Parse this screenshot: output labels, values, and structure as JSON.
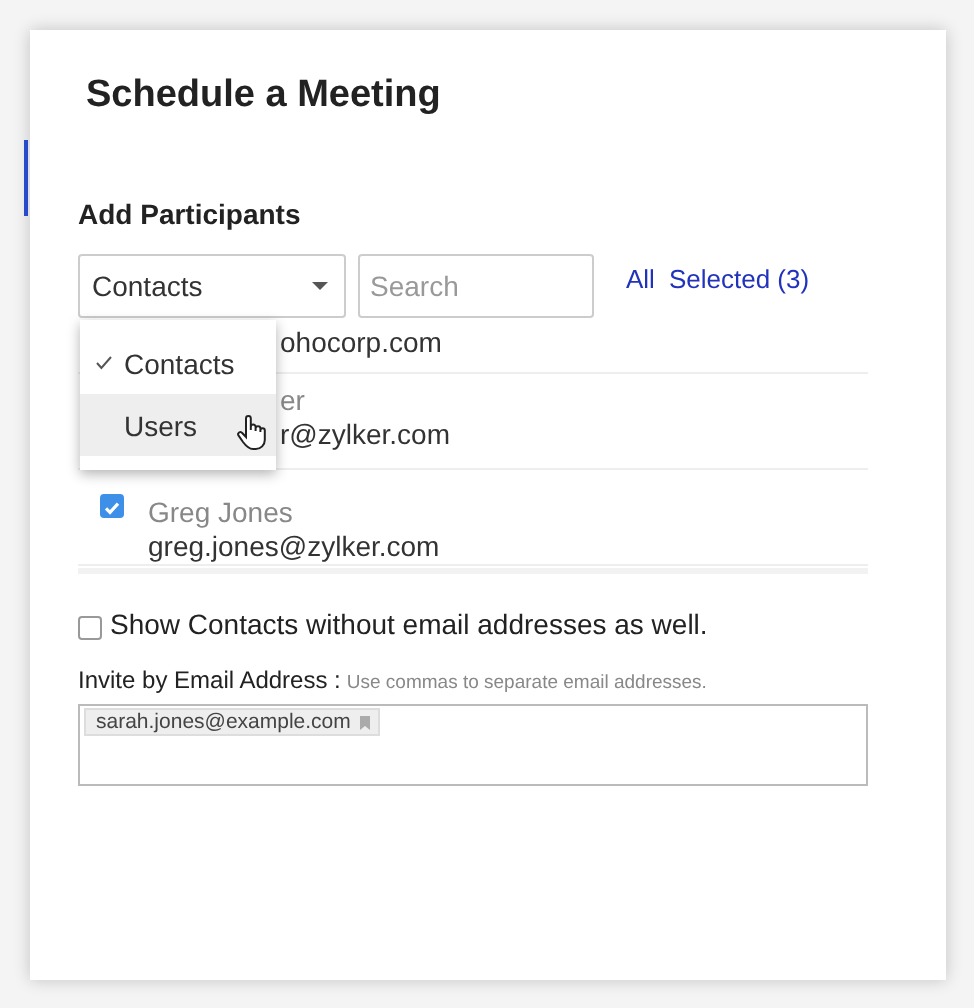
{
  "dialog": {
    "title": "Schedule a Meeting"
  },
  "participants": {
    "heading": "Add Participants",
    "source_select": {
      "value": "Contacts"
    },
    "search": {
      "placeholder": "Search"
    },
    "filters": [
      {
        "label": "All"
      },
      {
        "label": "Selected (3)"
      }
    ],
    "menu": [
      {
        "label": "Contacts",
        "checked": true,
        "hovered": false
      },
      {
        "label": "Users",
        "checked": false,
        "hovered": true
      }
    ],
    "rows": [
      {
        "kind": "covered",
        "name": "",
        "email": "ohocorp.com"
      },
      {
        "kind": "covered",
        "name": "er",
        "email": "r@zylker.com"
      },
      {
        "kind": "full",
        "name": "Greg Jones",
        "email": "greg.jones@zylker.com",
        "checked": true
      }
    ]
  },
  "show_without_email": {
    "label": "Show Contacts without email addresses as well.",
    "checked": false
  },
  "invite": {
    "label": "Invite by Email Address :",
    "hint": "Use commas to separate email addresses.",
    "chips": [
      "sarah.jones@example.com"
    ]
  }
}
